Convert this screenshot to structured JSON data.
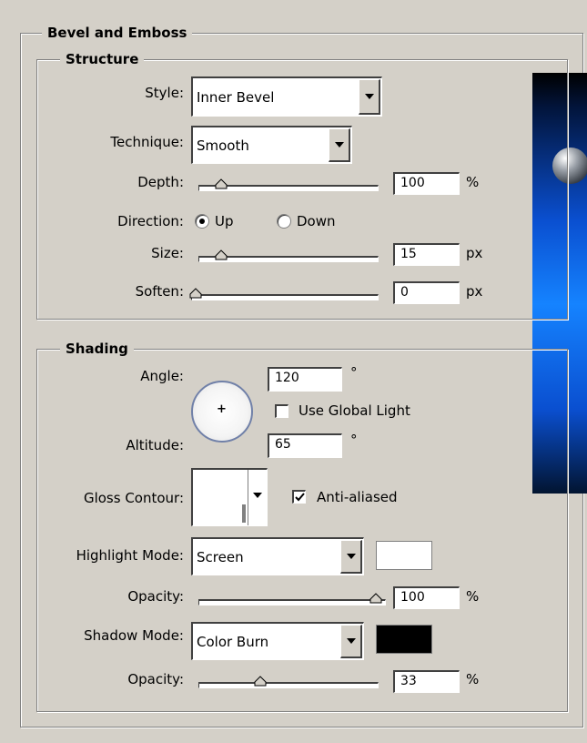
{
  "groups": {
    "bevel_emboss_title": "Bevel and Emboss",
    "structure_title": "Structure",
    "shading_title": "Shading"
  },
  "structure": {
    "style": {
      "label": "Style:",
      "value": "Inner Bevel"
    },
    "technique": {
      "label": "Technique:",
      "value": "Smooth"
    },
    "depth": {
      "label": "Depth:",
      "value": "100",
      "unit": "%",
      "slider_fraction": 0.1
    },
    "direction": {
      "label": "Direction:",
      "options": [
        "Up",
        "Down"
      ],
      "selected": "Up"
    },
    "size": {
      "label": "Size:",
      "value": "15",
      "unit": "px",
      "slider_fraction": 0.1
    },
    "soften": {
      "label": "Soften:",
      "value": "0",
      "unit": "px",
      "slider_fraction": 0.0
    }
  },
  "shading": {
    "angle": {
      "label": "Angle:",
      "value": "120",
      "unit": "°"
    },
    "use_global_light": {
      "label": "Use Global Light",
      "checked": false
    },
    "altitude": {
      "label": "Altitude:",
      "value": "65",
      "unit": "°"
    },
    "gloss_contour": {
      "label": "Gloss Contour:"
    },
    "anti_aliased": {
      "label": "Anti-aliased",
      "checked": true
    },
    "highlight_mode": {
      "label": "Highlight Mode:",
      "value": "Screen",
      "color": "#ffffff"
    },
    "highlight_opacity": {
      "label": "Opacity:",
      "value": "100",
      "unit": "%",
      "slider_fraction": 1.0
    },
    "shadow_mode": {
      "label": "Shadow Mode:",
      "value": "Color Burn",
      "color": "#000000"
    },
    "shadow_opacity": {
      "label": "Opacity:",
      "value": "33",
      "unit": "%",
      "slider_fraction": 0.33
    }
  },
  "preview": {
    "colors": [
      "#000a1a",
      "#0a6cff",
      "#001030"
    ]
  }
}
